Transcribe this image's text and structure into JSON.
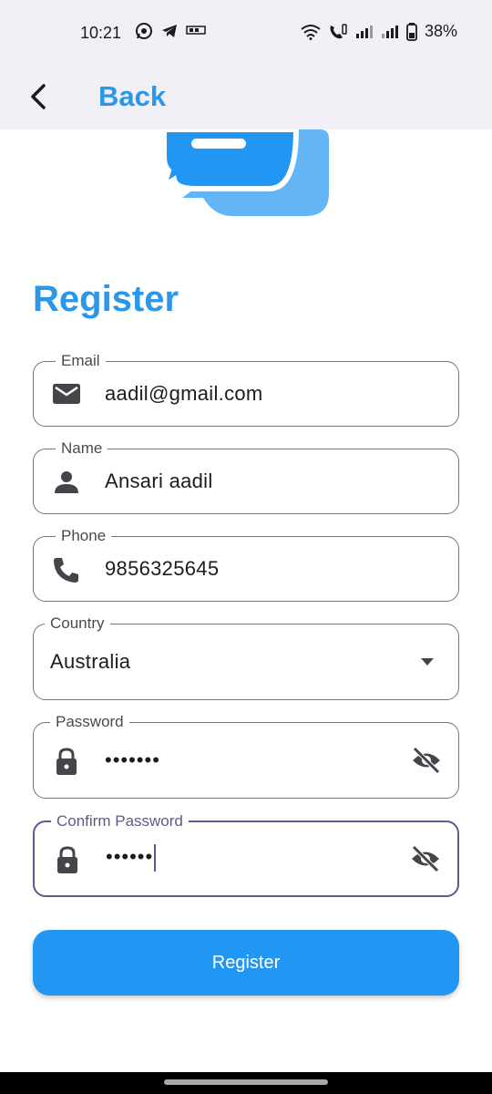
{
  "status_bar": {
    "time": "10:21",
    "battery": "38%"
  },
  "app_bar": {
    "back_label": "Back"
  },
  "page": {
    "title": "Register"
  },
  "form": {
    "email": {
      "label": "Email",
      "value": "aadil@gmail.com",
      "icon": "mail-icon"
    },
    "name": {
      "label": "Name",
      "value": "Ansari aadil",
      "icon": "person-icon"
    },
    "phone": {
      "label": "Phone",
      "value": "9856325645",
      "icon": "phone-icon"
    },
    "country": {
      "label": "Country",
      "value": "Australia",
      "icon": "dropdown-arrow-icon"
    },
    "password": {
      "label": "Password",
      "value": "•••••••",
      "icon": "lock-icon"
    },
    "confirm_password": {
      "label": "Confirm Password",
      "value": "••••••",
      "icon": "lock-icon"
    }
  },
  "actions": {
    "register_label": "Register"
  },
  "colors": {
    "accent": "#2c97e9",
    "button": "#2196f3",
    "focus": "#66558f",
    "app_bar_bg": "#f1f0f6"
  }
}
